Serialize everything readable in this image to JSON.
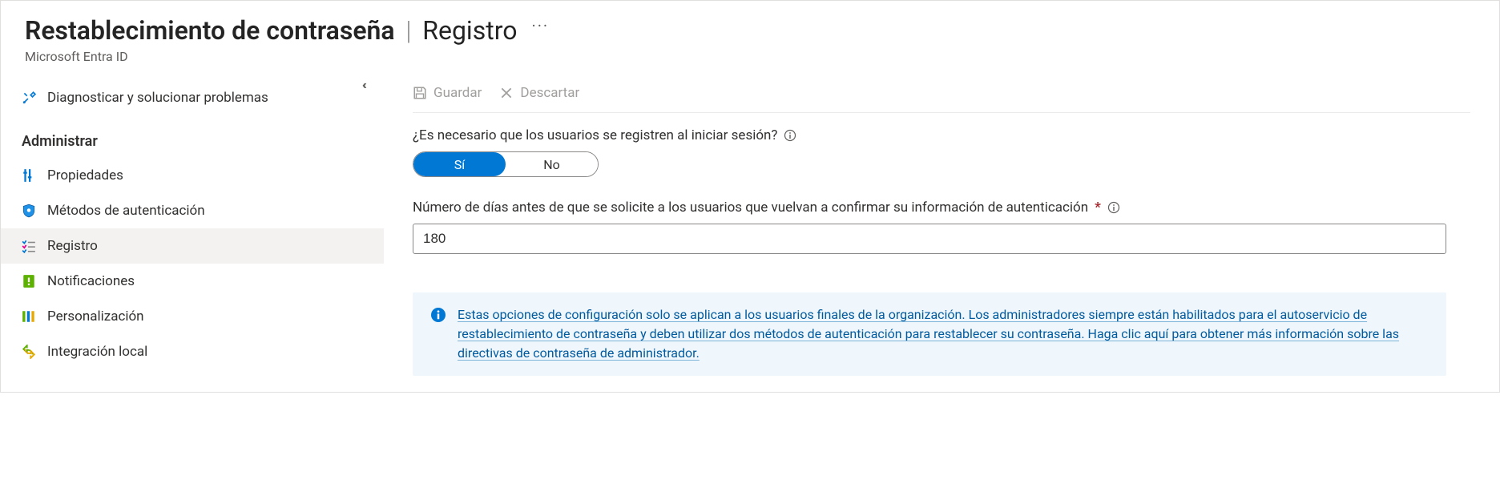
{
  "header": {
    "title_main": "Restablecimiento de contraseña",
    "title_section": "Registro",
    "breadcrumb": "Microsoft Entra ID"
  },
  "sidebar": {
    "diagnose_label": "Diagnosticar y solucionar problemas",
    "manage_header": "Administrar",
    "items": {
      "properties": "Propiedades",
      "auth_methods": "Métodos de autenticación",
      "registration": "Registro",
      "notifications": "Notificaciones",
      "customization": "Personalización",
      "onprem": "Integración local"
    }
  },
  "toolbar": {
    "save_label": "Guardar",
    "discard_label": "Descartar"
  },
  "form": {
    "require_register_label": "¿Es necesario que los usuarios se registren al iniciar sesión?",
    "toggle_yes": "Sí",
    "toggle_no": "No",
    "days_label": "Número de días antes de que se solicite a los usuarios que vuelvan a confirmar su información de autenticación",
    "days_value": "180"
  },
  "callout": {
    "text": "Estas opciones de configuración solo se aplican a los usuarios finales de la organización. Los administradores siempre están habilitados para el autoservicio de restablecimiento de contraseña y deben utilizar dos métodos de autenticación para restablecer su contraseña. Haga clic aquí para obtener más información sobre las directivas de contraseña de administrador."
  }
}
